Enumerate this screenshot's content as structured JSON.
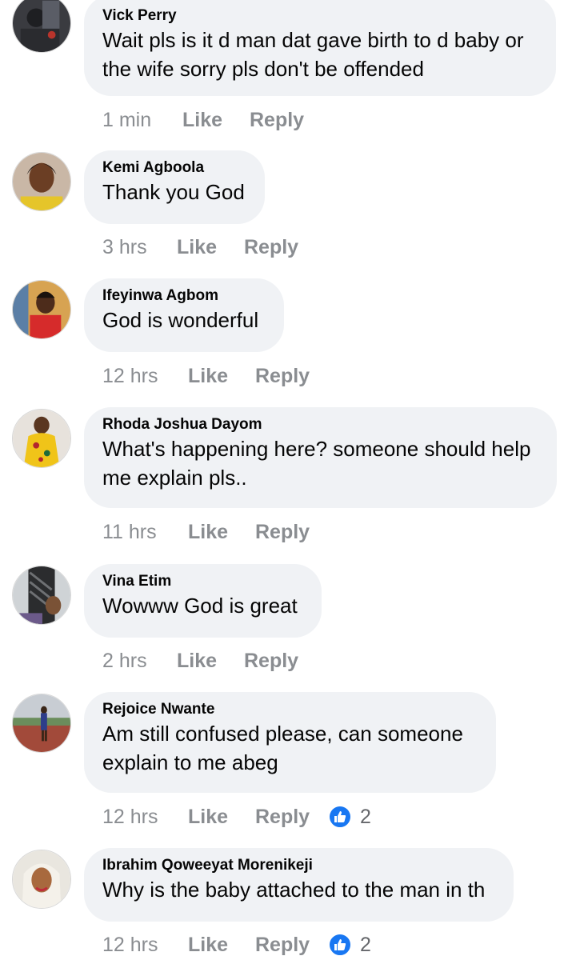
{
  "comments": [
    {
      "name": "Vick Perry",
      "text": "Wait pls is it d man dat gave birth to d baby or the wife sorry pls don't be offended",
      "time": "1 min",
      "like": "Like",
      "reply": "Reply",
      "reactions": "",
      "avatar": "avatar-vick"
    },
    {
      "name": "Kemi Agboola",
      "text": "Thank you God",
      "time": "3 hrs",
      "like": "Like",
      "reply": "Reply",
      "reactions": "",
      "avatar": "avatar-kemi"
    },
    {
      "name": "Ifeyinwa Agbom",
      "text": "God is wonderful",
      "time": "12 hrs",
      "like": "Like",
      "reply": "Reply",
      "reactions": "",
      "avatar": "avatar-ifeyinwa"
    },
    {
      "name": "Rhoda Joshua Dayom",
      "text": "What's happening here? someone should help me explain pls..",
      "time": "11 hrs",
      "like": "Like",
      "reply": "Reply",
      "reactions": "",
      "avatar": "avatar-rhoda"
    },
    {
      "name": "Vina Etim",
      "text": "Wowww God is great",
      "time": "2 hrs",
      "like": "Like",
      "reply": "Reply",
      "reactions": "",
      "avatar": "avatar-vina"
    },
    {
      "name": "Rejoice Nwante",
      "text": "Am still confused please, can someone explain to me abeg",
      "time": "12 hrs",
      "like": "Like",
      "reply": "Reply",
      "reactions": "2",
      "avatar": "avatar-rejoice"
    },
    {
      "name": "Ibrahim Qoweeyat Morenikeji",
      "text": "Why is the baby attached to the man in th",
      "time": "12 hrs",
      "like": "Like",
      "reply": "Reply",
      "reactions": "2",
      "avatar": "avatar-ibrahim"
    }
  ],
  "colors": {
    "bubble": "#f0f2f5",
    "meta": "#8a8d91",
    "like_reaction": "#1877f2"
  },
  "icons": {
    "reaction": "like-thumb-icon"
  }
}
